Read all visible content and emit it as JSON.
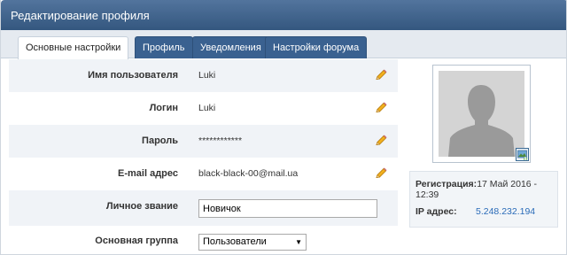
{
  "header": {
    "title": "Редактирование профиля"
  },
  "tabs": [
    {
      "label": "Основные настройки",
      "active": true
    },
    {
      "label": "Профиль",
      "active": false
    },
    {
      "label": "Уведомления",
      "active": false
    },
    {
      "label": "Настройки форума",
      "active": false
    }
  ],
  "fields": {
    "username": {
      "label": "Имя пользователя",
      "value": "Luki"
    },
    "login": {
      "label": "Логин",
      "value": "Luki"
    },
    "password": {
      "label": "Пароль",
      "value": "************"
    },
    "email": {
      "label": "E-mail адрес",
      "value": "black-black-00@mail.ua"
    },
    "rank": {
      "label": "Личное звание",
      "value": "Новичок"
    },
    "group": {
      "label": "Основная группа",
      "selected": "Пользователи"
    }
  },
  "info": {
    "reg_label": "Регистрация:",
    "reg_value": "17 Май 2016 - 12:39",
    "ip_label": "IP адрес:",
    "ip_value": "5.248.232.194"
  },
  "icons": {
    "edit": "pencil-icon",
    "avatar_upload": "image-upload-icon",
    "dropdown": "triangle-down-icon"
  },
  "colors": {
    "header": "#3b5f8a",
    "tab": "#3a6190",
    "link": "#2a6bb8",
    "row_shade": "#f0f3f7"
  }
}
